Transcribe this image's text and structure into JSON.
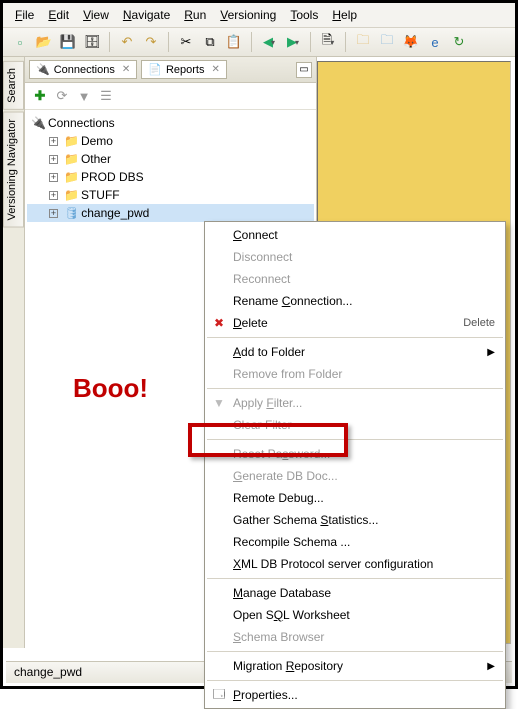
{
  "menubar": [
    "File",
    "Edit",
    "View",
    "Navigate",
    "Run",
    "Versioning",
    "Tools",
    "Help"
  ],
  "toolbar1": [
    {
      "name": "new-icon",
      "glyph": "▫",
      "color": "#4a7"
    },
    {
      "name": "open-icon",
      "glyph": "📂"
    },
    {
      "name": "save-icon",
      "glyph": "💾"
    },
    {
      "name": "save-all-icon",
      "glyph": "🗄"
    },
    {
      "sep": true
    },
    {
      "name": "undo-icon",
      "glyph": "↶",
      "color": "#c49a3a"
    },
    {
      "name": "redo-icon",
      "glyph": "↷",
      "color": "#c49a3a"
    },
    {
      "sep": true
    },
    {
      "name": "cut-icon",
      "glyph": "✂"
    },
    {
      "name": "copy-icon",
      "glyph": "⧉"
    },
    {
      "name": "paste-icon",
      "glyph": "📋"
    },
    {
      "sep": true
    },
    {
      "name": "back-icon",
      "glyph": "◀",
      "drop": true,
      "color": "#2a6"
    },
    {
      "name": "forward-icon",
      "glyph": "▶",
      "drop": true,
      "color": "#2a6"
    },
    {
      "sep": true
    },
    {
      "name": "sql-icon",
      "glyph": "🗎",
      "drop": true
    },
    {
      "sep": true
    },
    {
      "name": "ext1-icon",
      "glyph": "🗀",
      "color": "#e0b050"
    },
    {
      "name": "ext2-icon",
      "glyph": "🗀",
      "color": "#6aa8d8"
    },
    {
      "name": "firefox-icon",
      "glyph": "🦊"
    },
    {
      "name": "ie-icon",
      "glyph": "e",
      "color": "#2a6db8"
    },
    {
      "name": "reload-icon",
      "glyph": "↻",
      "color": "#2a8b2a"
    }
  ],
  "tabs": [
    {
      "icon": "🔌",
      "label": "Connections"
    },
    {
      "icon": "📄",
      "label": "Reports"
    }
  ],
  "navtoolbar": [
    {
      "name": "add-icon",
      "glyph": "✚",
      "cls": "green"
    },
    {
      "name": "refresh-icon",
      "glyph": "⟳",
      "cls": "grey"
    },
    {
      "name": "filter-icon",
      "glyph": "▼",
      "cls": "grey"
    },
    {
      "name": "tns-icon",
      "glyph": "☰",
      "cls": "grey"
    }
  ],
  "tree": {
    "root": "Connections",
    "items": [
      {
        "label": "Demo",
        "type": "folder"
      },
      {
        "label": "Other",
        "type": "folder"
      },
      {
        "label": "PROD DBS",
        "type": "folder"
      },
      {
        "label": "STUFF",
        "type": "folder"
      },
      {
        "label": "change_pwd",
        "type": "db",
        "selected": true
      }
    ]
  },
  "sidebar": [
    {
      "name": "search-panel",
      "label": "Search"
    },
    {
      "name": "versioning-panel",
      "label": "Versioning Navigator"
    }
  ],
  "annotation": {
    "text": "Booo!"
  },
  "context_menu": [
    {
      "label": "Connect",
      "u": 0,
      "enabled": true
    },
    {
      "label": "Disconnect",
      "enabled": false
    },
    {
      "label": "Reconnect",
      "enabled": false
    },
    {
      "label": "Rename Connection...",
      "u": 7,
      "enabled": true
    },
    {
      "label": "Delete",
      "u": 0,
      "enabled": true,
      "icon": "✖",
      "icolor": "#d02020",
      "shortcut": "Delete"
    },
    {
      "sep": true
    },
    {
      "label": "Add to Folder",
      "u": 0,
      "enabled": true,
      "submenu": true
    },
    {
      "label": "Remove from Folder",
      "enabled": false
    },
    {
      "sep": true
    },
    {
      "label": "Apply Filter...",
      "u": 6,
      "enabled": false,
      "icon": "▼",
      "icolor": "#bbb"
    },
    {
      "label": "Clear Filter",
      "enabled": false
    },
    {
      "sep": true
    },
    {
      "label": "Reset Password...",
      "u": 8,
      "enabled": false
    },
    {
      "label": "Generate DB Doc...",
      "u": 0,
      "enabled": false
    },
    {
      "label": "Remote Debug...",
      "enabled": true
    },
    {
      "label": "Gather Schema Statistics...",
      "u": 14,
      "enabled": true
    },
    {
      "label": "Recompile Schema ...",
      "enabled": true
    },
    {
      "label": "XML DB Protocol server configuration",
      "u": 0,
      "enabled": true
    },
    {
      "sep": true
    },
    {
      "label": "Manage Database",
      "u": 0,
      "enabled": true
    },
    {
      "label": "Open SQL Worksheet",
      "u": 6,
      "enabled": true
    },
    {
      "label": "Schema Browser",
      "u": 0,
      "enabled": false
    },
    {
      "sep": true
    },
    {
      "label": "Migration Repository",
      "u": 10,
      "enabled": true,
      "submenu": true
    },
    {
      "sep": true
    },
    {
      "label": "Properties...",
      "u": 0,
      "enabled": true,
      "icon": "🗔"
    }
  ],
  "status": "change_pwd"
}
